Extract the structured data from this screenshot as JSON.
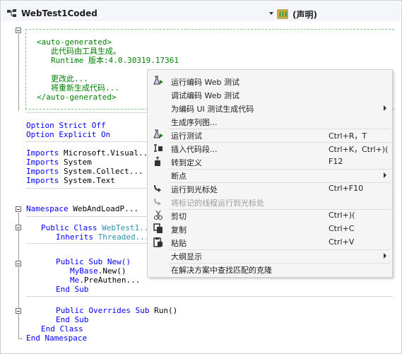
{
  "header": {
    "class_name": "WebTest1Coded",
    "declarations": "(声明)"
  },
  "code": {
    "l1": "<auto-generated>",
    "l2": "此代码由工具生成。",
    "l3": "Runtime 版本:4.0.30319.17361",
    "l4": "更改此...",
    "l5": "将重新生成代码...",
    "l6": "</auto-generated>",
    "option": "Option",
    "strict": "Strict",
    "off": "Off",
    "explicit": "Explicit",
    "on": "On",
    "imports": "Imports",
    "imp1": "Microsoft.Visual...",
    "imp2": "System",
    "imp3": "System.Collect...",
    "imp4": "System.Text",
    "namespace": "Namespace",
    "ns_name": "WebAndLoadP...",
    "public": "Public",
    "class": "Class",
    "class_name": "WebTest1...",
    "inherits": "Inherits",
    "base": "Threaded...",
    "sub": "Sub",
    "new": "New()",
    "mybase": "MyBase",
    "mybase_new": ".New()",
    "me": "Me",
    "me_pre": ".PreAuthen...",
    "end": "End",
    "overrides": "Overrides",
    "run": "Run()"
  },
  "menu": {
    "items": [
      {
        "label": "运行编码 Web 测试",
        "shortcut": "",
        "icon": "run-test-icon"
      },
      {
        "label": "调试编码 Web 测试",
        "shortcut": "",
        "icon": ""
      },
      {
        "label": "为编码 UI 测试生成代码",
        "shortcut": "",
        "icon": ""
      },
      {
        "label": "生成序列图...",
        "shortcut": "",
        "icon": ""
      },
      {
        "label": "运行测试",
        "shortcut": "Ctrl+R，T",
        "icon": "run-test-icon"
      },
      {
        "label": "插入代码段...",
        "shortcut": "Ctrl+K，Ctrl+)(",
        "icon": "insert-snippet-icon"
      },
      {
        "label": "转到定义",
        "shortcut": "F12",
        "icon": "go-to-definition-icon"
      },
      {
        "label": "断点",
        "shortcut": "",
        "icon": ""
      },
      {
        "label": "运行到光标处",
        "shortcut": "Ctrl+F10",
        "icon": "run-to-cursor-icon"
      },
      {
        "label": "将标记的线程运行到光标处",
        "shortcut": "",
        "icon": "run-flagged-threads-icon"
      },
      {
        "label": "剪切",
        "shortcut": "Ctrl+)(",
        "icon": "cut-icon"
      },
      {
        "label": "复制",
        "shortcut": "Ctrl+C",
        "icon": "copy-icon"
      },
      {
        "label": "粘贴",
        "shortcut": "Ctrl+V",
        "icon": "paste-icon"
      },
      {
        "label": "大纲显示",
        "shortcut": "",
        "icon": ""
      },
      {
        "label": "在解决方案中查找匹配的克隆",
        "shortcut": "",
        "icon": ""
      }
    ]
  }
}
